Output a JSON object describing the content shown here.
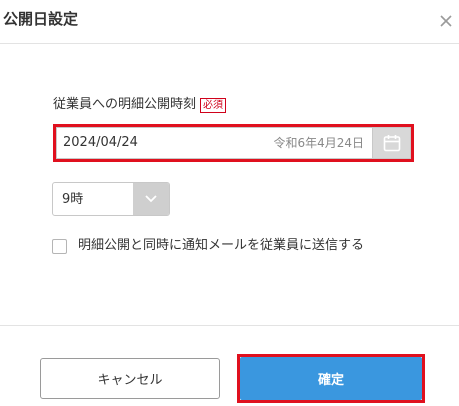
{
  "dialog": {
    "title": "公開日設定",
    "close_icon": "close-icon"
  },
  "form": {
    "publish_label": "従業員への明細公開時刻",
    "required_badge": "必須",
    "date_value": "2024/04/24",
    "date_era": "令和6年4月24日",
    "calendar_icon": "calendar-icon",
    "hour_value": "9時",
    "hour_arrow_icon": "chevron-down-icon",
    "notify_checked": false,
    "notify_label": "明細公開と同時に通知メールを従業員に送信する"
  },
  "footer": {
    "cancel_label": "キャンセル",
    "confirm_label": "確定"
  },
  "colors": {
    "primary": "#3a97df",
    "highlight": "#e0101e",
    "required": "#d0021b"
  }
}
